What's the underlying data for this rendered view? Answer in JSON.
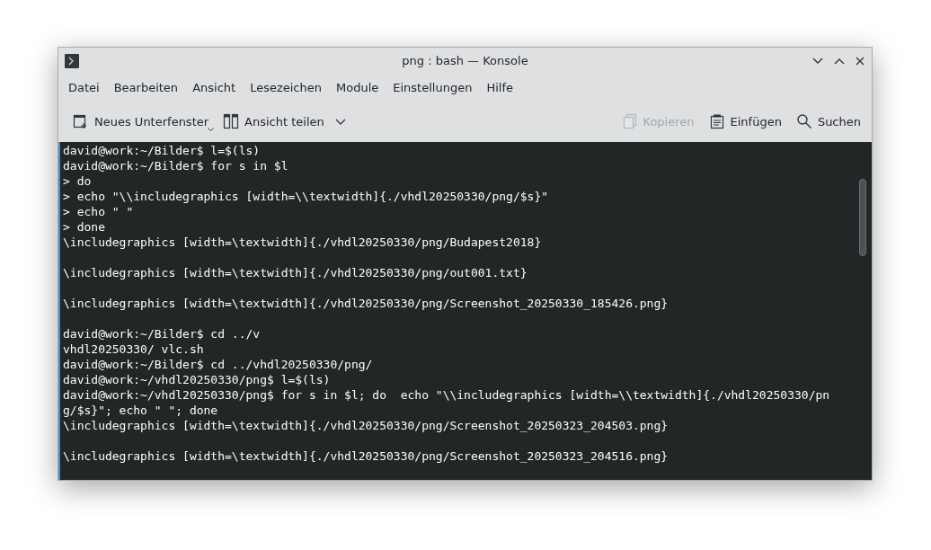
{
  "window": {
    "title": "png : bash — Konsole"
  },
  "menu": [
    "Datei",
    "Bearbeiten",
    "Ansicht",
    "Lesezeichen",
    "Module",
    "Einstellungen",
    "Hilfe"
  ],
  "toolbar": {
    "left": [
      {
        "kind": "new-tab",
        "label": "Neues Unterfenster",
        "disabled": false
      },
      {
        "kind": "split",
        "label": "Ansicht teilen",
        "disabled": false
      }
    ],
    "right": [
      {
        "kind": "copy",
        "label": "Kopieren",
        "disabled": true
      },
      {
        "kind": "paste",
        "label": "Einfügen",
        "disabled": false
      },
      {
        "kind": "search",
        "label": "Suchen",
        "disabled": false
      }
    ]
  },
  "terminal": {
    "lines": [
      {
        "kind": "text",
        "text": "david@work:~/Bilder$ l=$(ls)"
      },
      {
        "kind": "text",
        "text": "david@work:~/Bilder$ for s in $l"
      },
      {
        "kind": "text",
        "text": "> do"
      },
      {
        "kind": "text",
        "text": "> echo \"\\\\includegraphics [width=\\\\textwidth]{./vhdl20250330/png/$s}\""
      },
      {
        "kind": "text",
        "text": "> echo \" \""
      },
      {
        "kind": "text",
        "text": "> done"
      },
      {
        "kind": "text",
        "text": "\\includegraphics [width=\\textwidth]{./vhdl20250330/png/Budapest2018}"
      },
      {
        "kind": "blank"
      },
      {
        "kind": "text",
        "text": "\\includegraphics [width=\\textwidth]{./vhdl20250330/png/out001.txt}"
      },
      {
        "kind": "blank"
      },
      {
        "kind": "text",
        "text": "\\includegraphics [width=\\textwidth]{./vhdl20250330/png/Screenshot_20250330_185426.png}"
      },
      {
        "kind": "blank"
      },
      {
        "kind": "text",
        "text": "david@work:~/Bilder$ cd ../v"
      },
      {
        "kind": "text",
        "text": "vhdl20250330/ vlc.sh"
      },
      {
        "kind": "text",
        "text": "david@work:~/Bilder$ cd ../vhdl20250330/png/"
      },
      {
        "kind": "text",
        "text": "david@work:~/vhdl20250330/png$ l=$(ls)"
      },
      {
        "kind": "text",
        "text": "david@work:~/vhdl20250330/png$ for s in $l; do  echo \"\\\\includegraphics [width=\\\\textwidth]{./vhdl20250330/pn"
      },
      {
        "kind": "text",
        "text": "g/$s}\"; echo \" \"; done"
      },
      {
        "kind": "text",
        "text": "\\includegraphics [width=\\textwidth]{./vhdl20250330/png/Screenshot_20250323_204503.png}"
      },
      {
        "kind": "blank"
      },
      {
        "kind": "text",
        "text": "\\includegraphics [width=\\textwidth]{./vhdl20250330/png/Screenshot_20250323_204516.png}"
      }
    ]
  }
}
